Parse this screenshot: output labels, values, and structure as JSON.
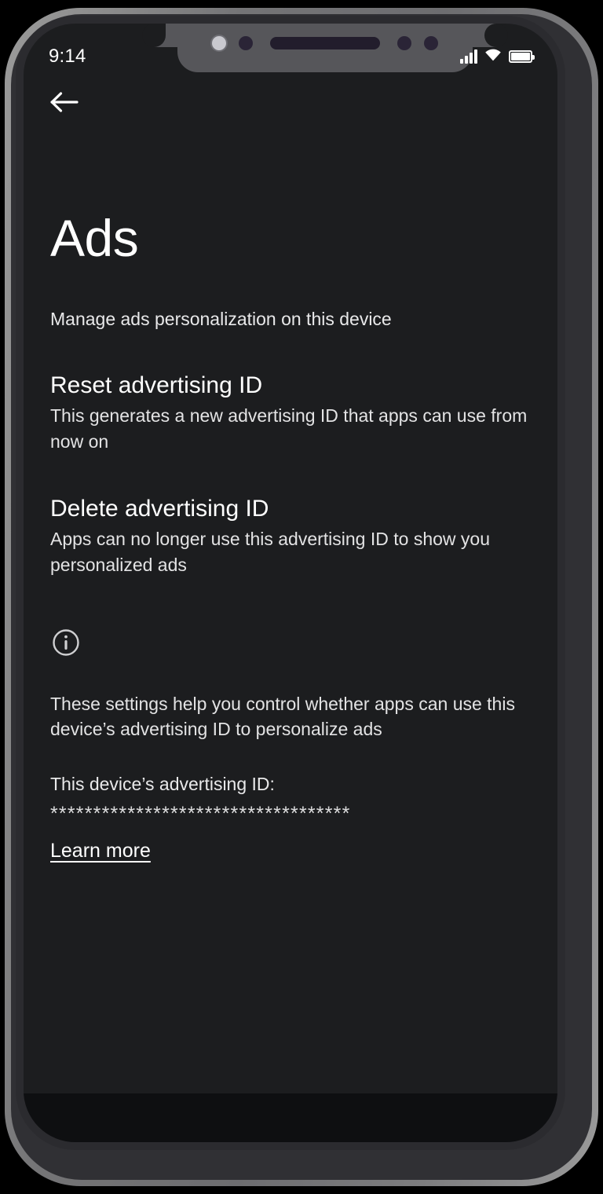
{
  "status_bar": {
    "time": "9:14",
    "signal_icon": "signal-bars-icon",
    "signal_bars": 4,
    "wifi_icon": "wifi-icon",
    "battery_icon": "battery-icon",
    "battery_level": "full"
  },
  "nav": {
    "back_icon": "back-arrow-icon",
    "back_label": "Back"
  },
  "page": {
    "title": "Ads",
    "subtitle": "Manage ads personalization on this device"
  },
  "sections": [
    {
      "title": "Reset advertising ID",
      "description": "This generates a new advertising ID that apps can use from now on"
    },
    {
      "title": "Delete advertising ID",
      "description": "Apps can no longer use this advertising ID to show you personalized ads"
    }
  ],
  "info": {
    "icon": "info-circle-icon",
    "note": "These settings help you control whether apps can use this device’s advertising ID to personalize ads",
    "adid_label": "This device’s advertising ID:",
    "adid_value": "***********************************",
    "learn_more_label": "Learn more"
  },
  "colors": {
    "screen_background": "#1c1d1f",
    "text_primary": "#ffffff",
    "text_secondary": "#e3e3e4",
    "frame_outer": "#8d8d8d",
    "frame_body": "#303034",
    "notch": "#56565a"
  }
}
